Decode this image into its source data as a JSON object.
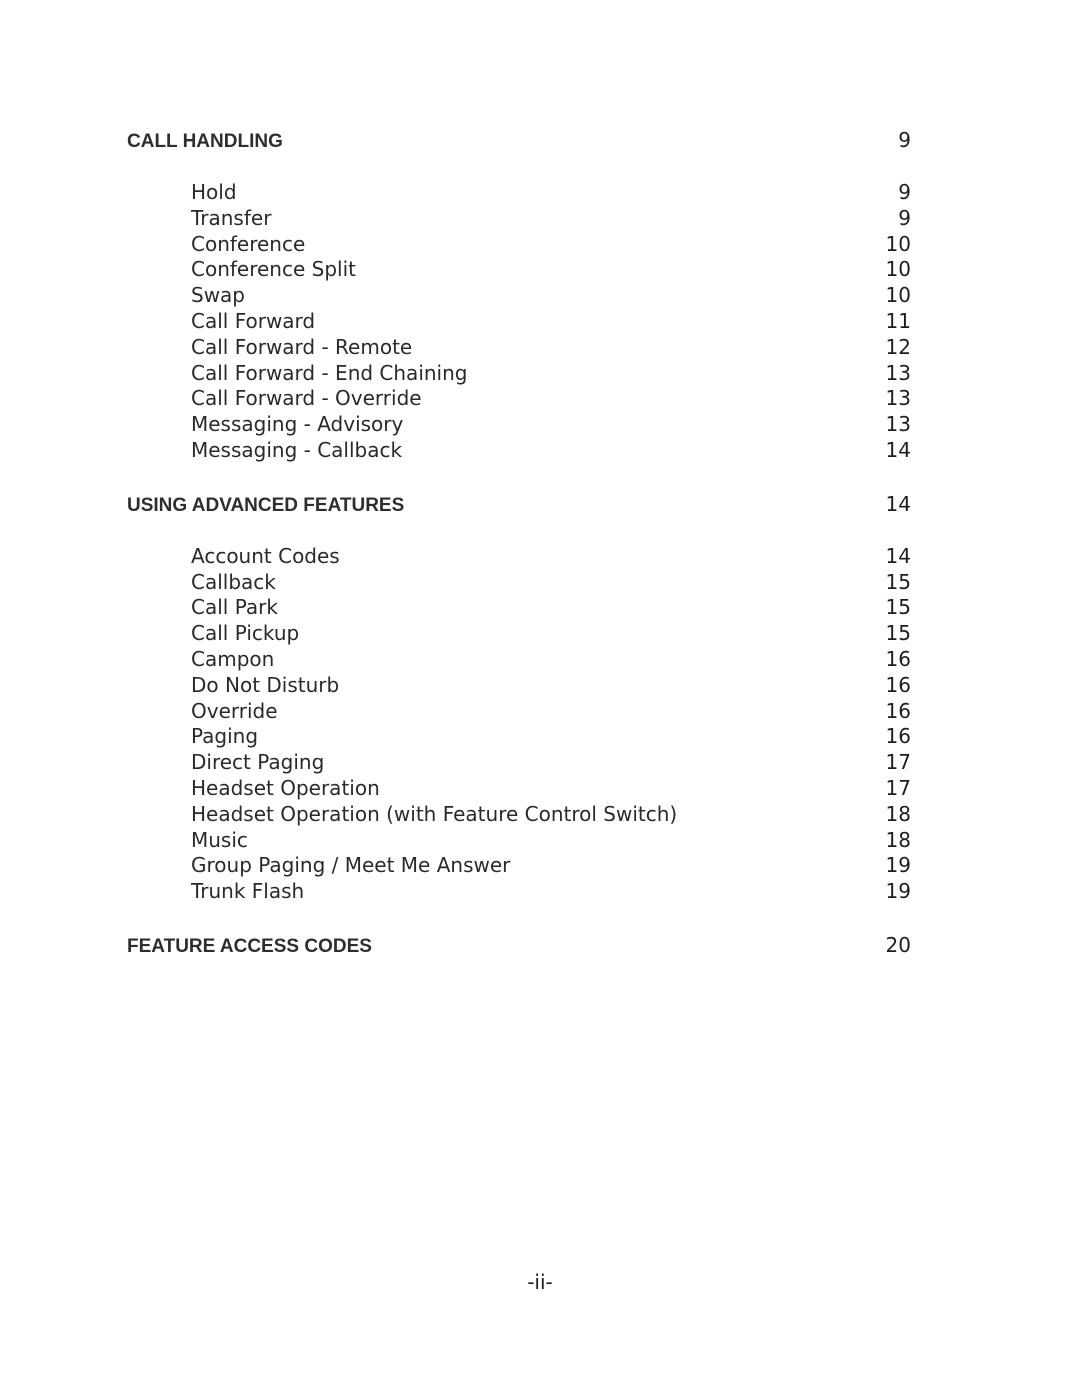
{
  "document": {
    "type": "table-of-contents",
    "footer_page_label": "-ii-"
  },
  "sections": [
    {
      "heading": "CALL HANDLING",
      "page": "9",
      "entries": [
        {
          "title": "Hold",
          "page": "9"
        },
        {
          "title": "Transfer",
          "page": "9"
        },
        {
          "title": "Conference",
          "page": "10"
        },
        {
          "title": "Conference Split",
          "page": "10"
        },
        {
          "title": "Swap",
          "page": "10"
        },
        {
          "title": "Call Forward",
          "page": "11"
        },
        {
          "title": "Call Forward - Remote",
          "page": "12"
        },
        {
          "title": "Call Forward - End Chaining",
          "page": "13"
        },
        {
          "title": "Call Forward - Override",
          "page": "13"
        },
        {
          "title": "Messaging - Advisory",
          "page": "13"
        },
        {
          "title": "Messaging - Callback",
          "page": "14"
        }
      ]
    },
    {
      "heading": "USING ADVANCED FEATURES",
      "page": "14",
      "entries": [
        {
          "title": "Account Codes",
          "page": "14"
        },
        {
          "title": "Callback",
          "page": "15"
        },
        {
          "title": "Call Park",
          "page": "15"
        },
        {
          "title": "Call Pickup",
          "page": "15"
        },
        {
          "title": "Campon",
          "page": "16"
        },
        {
          "title": "Do Not Disturb",
          "page": "16"
        },
        {
          "title": "Override",
          "page": "16"
        },
        {
          "title": "Paging",
          "page": "16"
        },
        {
          "title": "Direct Paging",
          "page": "17"
        },
        {
          "title": "Headset Operation",
          "page": "17"
        },
        {
          "title": "Headset Operation (with Feature Control Switch)",
          "page": "18"
        },
        {
          "title": "Music",
          "page": "18"
        },
        {
          "title": "Group Paging / Meet Me Answer",
          "page": "19"
        },
        {
          "title": "Trunk Flash",
          "page": "19"
        }
      ]
    },
    {
      "heading": "FEATURE ACCESS CODES",
      "page": "20",
      "entries": []
    }
  ]
}
